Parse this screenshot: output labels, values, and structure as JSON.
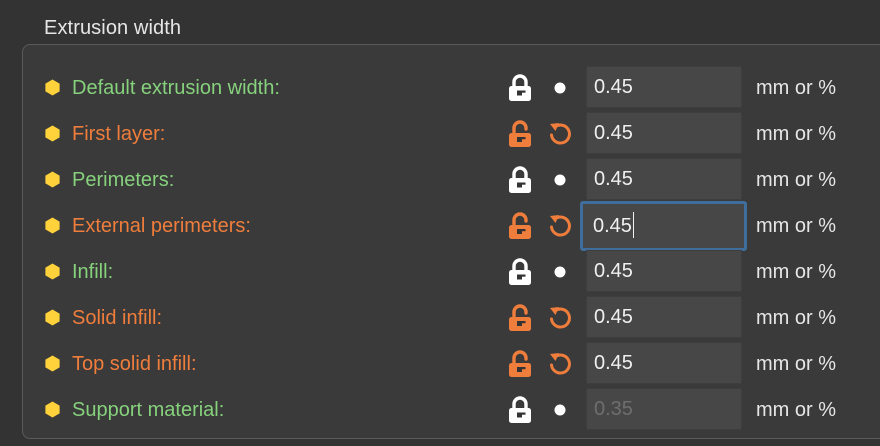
{
  "group": {
    "title": "Extrusion width"
  },
  "colors": {
    "system_label": "#86d17c",
    "modified_label": "#ef7d3c",
    "bullet": "#ffd23c",
    "focus_border": "#3f6e9c"
  },
  "rows": [
    {
      "label": "Default extrusion width:",
      "value": "0.45",
      "units": "mm or %",
      "state": "system",
      "lock_icon": "lock-closed-icon",
      "reset_icon": "dot-icon"
    },
    {
      "label": "First layer:",
      "value": "0.45",
      "units": "mm or %",
      "state": "modified",
      "lock_icon": "lock-open-icon",
      "reset_icon": "undo-arrow-icon"
    },
    {
      "label": "Perimeters:",
      "value": "0.45",
      "units": "mm or %",
      "state": "system",
      "lock_icon": "lock-closed-icon",
      "reset_icon": "dot-icon"
    },
    {
      "label": "External perimeters:",
      "value": "0.45",
      "units": "mm or %",
      "state": "modified",
      "lock_icon": "lock-open-icon",
      "reset_icon": "undo-arrow-icon",
      "focused": true
    },
    {
      "label": "Infill:",
      "value": "0.45",
      "units": "mm or %",
      "state": "system",
      "lock_icon": "lock-closed-icon",
      "reset_icon": "dot-icon"
    },
    {
      "label": "Solid infill:",
      "value": "0.45",
      "units": "mm or %",
      "state": "modified",
      "lock_icon": "lock-open-icon",
      "reset_icon": "undo-arrow-icon"
    },
    {
      "label": "Top solid infill:",
      "value": "0.45",
      "units": "mm or %",
      "state": "modified",
      "lock_icon": "lock-open-icon",
      "reset_icon": "undo-arrow-icon"
    },
    {
      "label": "Support material:",
      "value": "0.35",
      "units": "mm or %",
      "state": "system",
      "lock_icon": "lock-closed-icon",
      "reset_icon": "dot-icon",
      "disabled": true
    }
  ]
}
